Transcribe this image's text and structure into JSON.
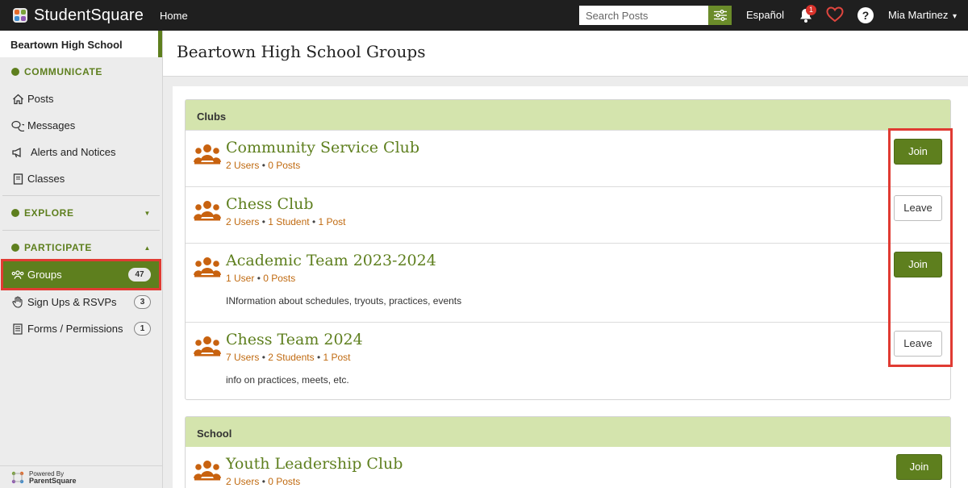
{
  "topbar": {
    "app_name": "StudentSquare",
    "home_label": "Home",
    "search_placeholder": "Search Posts",
    "language_label": "Español",
    "notification_count": "1",
    "help_label": "?",
    "user_name": "Mia Martinez",
    "user_caret": "▾"
  },
  "sidebar": {
    "school_name": "Beartown High School",
    "sections": {
      "communicate": "COMMUNICATE",
      "explore": "EXPLORE",
      "participate": "PARTICIPATE"
    },
    "communicate_items": {
      "posts": "Posts",
      "messages": "Messages",
      "alerts": "Alerts and Notices",
      "classes": "Classes"
    },
    "participate_items": {
      "groups": "Groups",
      "groups_count": "47",
      "signups": "Sign Ups & RSVPs",
      "signups_count": "3",
      "forms": "Forms / Permissions",
      "forms_count": "1"
    },
    "powered_by": "Powered By",
    "powered_brand": "ParentSquare"
  },
  "page": {
    "title": "Beartown High School Groups"
  },
  "clubs": {
    "heading": "Clubs",
    "groups": [
      {
        "name": "Community Service Club",
        "meta": [
          "2 Users",
          "0 Posts"
        ],
        "description": "",
        "action": "Join"
      },
      {
        "name": "Chess Club",
        "meta": [
          "2 Users",
          "1 Student",
          "1 Post"
        ],
        "description": "",
        "action": "Leave"
      },
      {
        "name": "Academic Team 2023-2024",
        "meta": [
          "1 User",
          "0 Posts"
        ],
        "description": "INformation about schedules, tryouts, practices, events",
        "action": "Join"
      },
      {
        "name": "Chess Team 2024",
        "meta": [
          "7 Users",
          "2 Students",
          "1 Post"
        ],
        "description": "info on practices, meets, etc.",
        "action": "Leave"
      }
    ]
  },
  "school": {
    "heading": "School",
    "groups": [
      {
        "name": "Youth Leadership Club",
        "meta": [
          "2 Users",
          "0 Posts"
        ],
        "description": "",
        "action": "Join"
      }
    ]
  },
  "meta_separator": "•",
  "colors": {
    "brand_green": "#5e7f1e",
    "header_tint": "#d4e4ad",
    "meta_orange": "#c06a10",
    "highlight_red": "#e03b33"
  }
}
